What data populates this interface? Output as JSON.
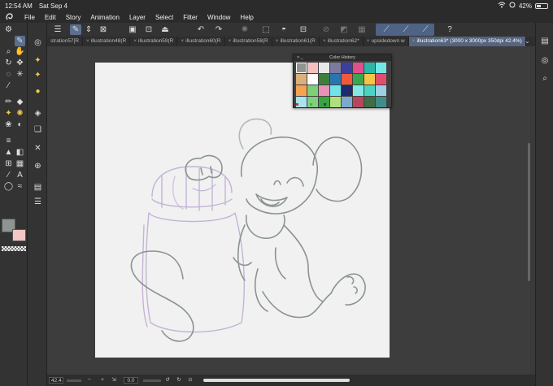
{
  "status": {
    "time": "12:54 AM",
    "date": "Sat Sep 4",
    "battery": "42%",
    "battery_level": 0.42
  },
  "menu": [
    "File",
    "Edit",
    "Story",
    "Animation",
    "Layer",
    "Select",
    "Filter",
    "Window",
    "Help"
  ],
  "tabs": [
    {
      "label": "stration57[R"
    },
    {
      "label": "illustration48(R"
    },
    {
      "label": "illustration59(R"
    },
    {
      "label": "illustration60(R"
    },
    {
      "label": "illustration58(R"
    },
    {
      "label": "illustration61(R"
    },
    {
      "label": "illustration62*"
    },
    {
      "label": "upsidedown w"
    },
    {
      "label": "illustration63* (3000 x 3000px 350dpi 42.4%)"
    }
  ],
  "color_history": {
    "title": "Color History",
    "colors": [
      "#8f9691",
      "#f4c0c0",
      "#e8e8e8",
      "#7d7a9f",
      "#3e3f9a",
      "#e24f8e",
      "#2bb6a7",
      "#72e9e8",
      "#dcb07c",
      "#ffffff",
      "#3f7d3d",
      "#2a74b0",
      "#f05a3a",
      "#3aa64f",
      "#f3c648",
      "#e24d6e",
      "#f4a352",
      "#7ecf7a",
      "#e792b7",
      "#6fe3e8",
      "#1b2b6b",
      "#82e9e6",
      "#4bd3c4",
      "#9ecfe6",
      "#a8e3ee",
      "#7ed07c",
      "#3aa33d",
      "#aee17e",
      "#7ba9cf",
      "#b7475f",
      "#3f6b47",
      "#3e8d8a"
    ],
    "footer_dots": [
      "#c0392b",
      "#4caf50",
      "#1f3a93"
    ]
  },
  "bottom": {
    "zoom": "42.4",
    "angle": "0.0"
  },
  "colors": {
    "main_color": "#8e9590",
    "sub_color": "#f2c8c4",
    "accent": "#5b6f8e",
    "stroke_green": "#8a948d",
    "stroke_purple": "#c2b2d2"
  }
}
